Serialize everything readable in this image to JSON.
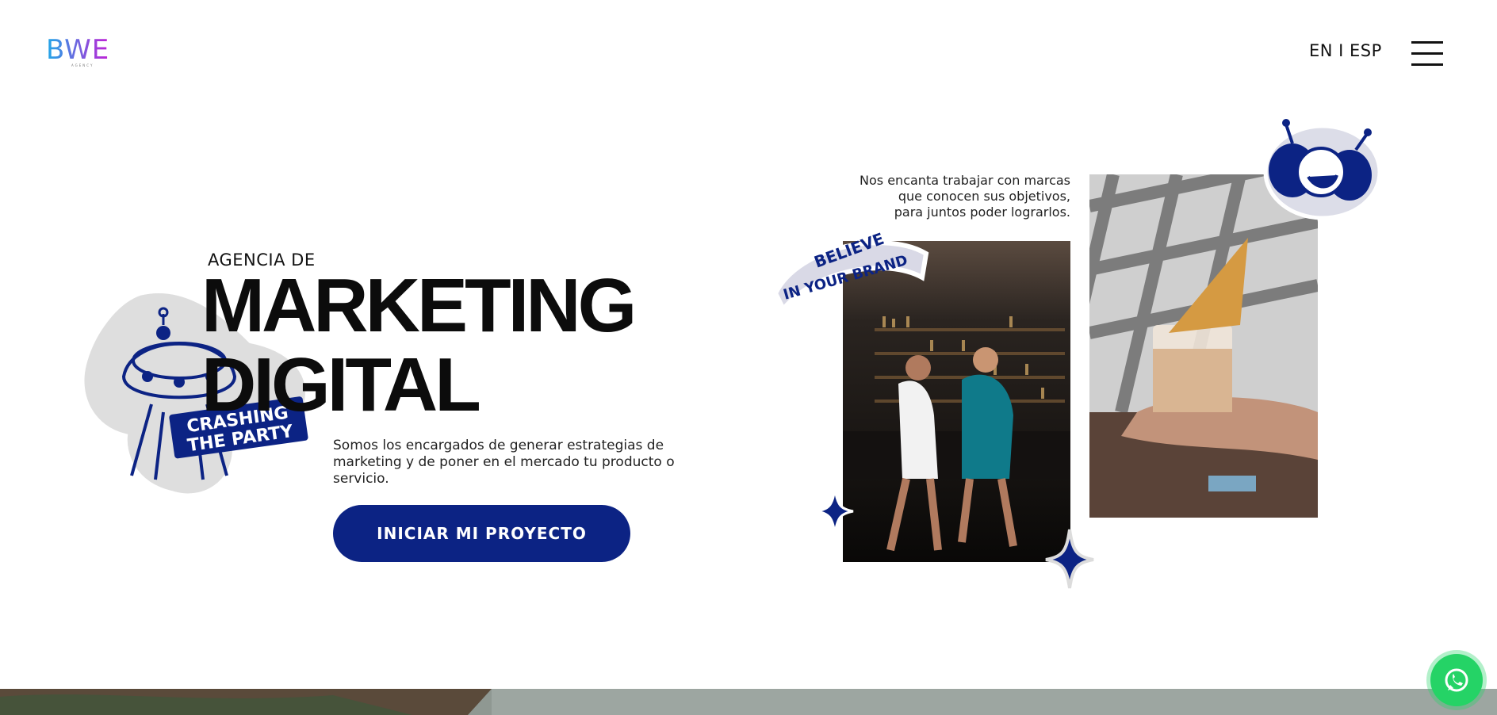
{
  "header": {
    "logo_text": "BWE",
    "logo_subtext": "AGENCY",
    "language_switch": "EN I ESP",
    "menu_icon": "hamburger-menu-icon"
  },
  "hero": {
    "eyebrow": "AGENCIA DE",
    "headline_line1": "MARKETING",
    "headline_line2": "DIGITAL",
    "description": "Somos los encargados de generar estrategias de marketing y de poner en el mercado tu producto o servicio.",
    "cta_label": "INICIAR MI PROYECTO",
    "sticker_ufo_text_line1": "CRASHING",
    "sticker_ufo_text_line2": "THE PARTY"
  },
  "side": {
    "quote_line1": "Nos encanta trabajar con marcas",
    "quote_line2": "que conocen sus objetivos,",
    "quote_line3": "para juntos poder lograrlos.",
    "sticker_brand_line1": "BELIEVE",
    "sticker_brand_line2": "IN YOUR BRAND"
  },
  "floating": {
    "whatsapp_icon": "whatsapp-icon"
  },
  "colors": {
    "brand_blue": "#0c2384",
    "whatsapp_green": "#25d366",
    "logo_cyan": "#1fa9e8",
    "logo_magenta": "#c21fd6"
  }
}
